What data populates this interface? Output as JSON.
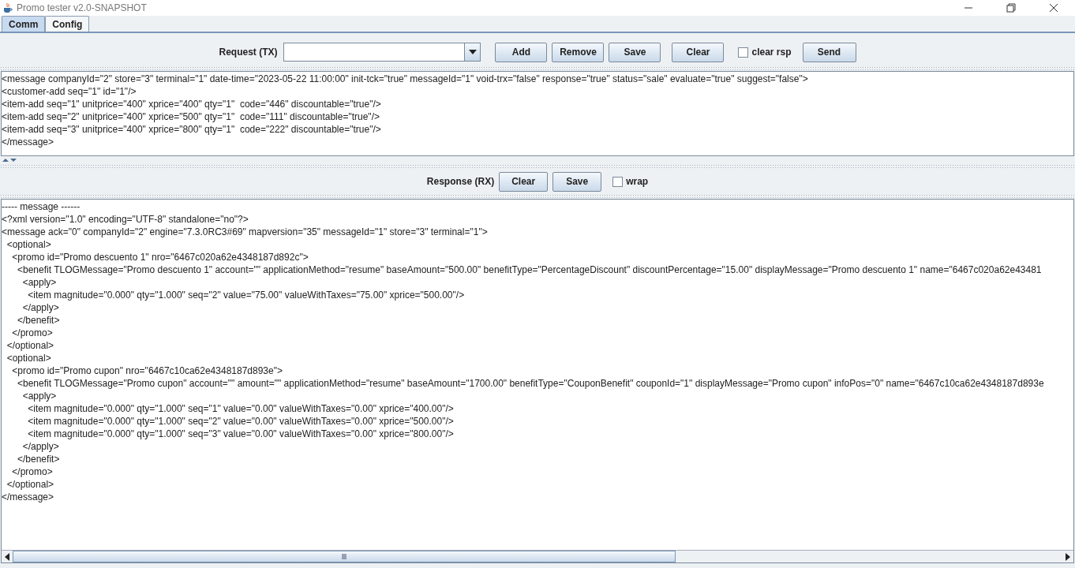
{
  "window": {
    "title": "Promo tester v2.0-SNAPSHOT"
  },
  "tabs": [
    {
      "label": "Comm",
      "selected": true
    },
    {
      "label": "Config",
      "selected": false
    }
  ],
  "request": {
    "label": "Request (TX)",
    "buttons": [
      "Add",
      "Remove",
      "Save",
      "Clear"
    ],
    "clear_rsp": {
      "label": "clear rsp",
      "checked": false
    },
    "send": "Send",
    "lines": [
      "<message companyId=\"2\" store=\"3\" terminal=\"1\" date-time=\"2023-05-22 11:00:00\" init-tck=\"true\" messageId=\"1\" void-trx=\"false\" response=\"true\" status=\"sale\" evaluate=\"true\" suggest=\"false\">",
      "<customer-add seq=\"1\" id=\"1\"/>",
      "<item-add seq=\"1\" unitprice=\"400\" xprice=\"400\" qty=\"1\"  code=\"446\" discountable=\"true\"/>",
      "<item-add seq=\"2\" unitprice=\"400\" xprice=\"500\" qty=\"1\"  code=\"111\" discountable=\"true\"/>",
      "<item-add seq=\"3\" unitprice=\"400\" xprice=\"800\" qty=\"1\"  code=\"222\" discountable=\"true\"/>",
      "</message>"
    ]
  },
  "response": {
    "label": "Response (RX)",
    "buttons": [
      "Clear",
      "Save"
    ],
    "wrap": {
      "label": "wrap",
      "checked": false
    },
    "lines": [
      "----- message ------",
      "<?xml version=\"1.0\" encoding=\"UTF-8\" standalone=\"no\"?>",
      "<message ack=\"0\" companyId=\"2\" engine=\"7.3.0RC3#69\" mapversion=\"35\" messageId=\"1\" store=\"3\" terminal=\"1\">",
      "  <optional>",
      "    <promo id=\"Promo descuento 1\" nro=\"6467c020a62e4348187d892c\">",
      "      <benefit TLOGMessage=\"Promo descuento 1\" account=\"\" applicationMethod=\"resume\" baseAmount=\"500.00\" benefitType=\"PercentageDiscount\" discountPercentage=\"15.00\" displayMessage=\"Promo descuento 1\" name=\"6467c020a62e43481",
      "        <apply>",
      "          <item magnitude=\"0.000\" qty=\"1.000\" seq=\"2\" value=\"75.00\" valueWithTaxes=\"75.00\" xprice=\"500.00\"/>",
      "        </apply>",
      "      </benefit>",
      "    </promo>",
      "  </optional>",
      "  <optional>",
      "    <promo id=\"Promo cupon\" nro=\"6467c10ca62e4348187d893e\">",
      "      <benefit TLOGMessage=\"Promo cupon\" account=\"\" amount=\"\" applicationMethod=\"resume\" baseAmount=\"1700.00\" benefitType=\"CouponBenefit\" couponId=\"1\" displayMessage=\"Promo cupon\" infoPos=\"0\" name=\"6467c10ca62e4348187d893e",
      "        <apply>",
      "          <item magnitude=\"0.000\" qty=\"1.000\" seq=\"1\" value=\"0.00\" valueWithTaxes=\"0.00\" xprice=\"400.00\"/>",
      "          <item magnitude=\"0.000\" qty=\"1.000\" seq=\"2\" value=\"0.00\" valueWithTaxes=\"0.00\" xprice=\"500.00\"/>",
      "          <item magnitude=\"0.000\" qty=\"1.000\" seq=\"3\" value=\"0.00\" valueWithTaxes=\"0.00\" xprice=\"800.00\"/>",
      "        </apply>",
      "      </benefit>",
      "    </promo>",
      "  </optional>",
      "</message>"
    ]
  }
}
